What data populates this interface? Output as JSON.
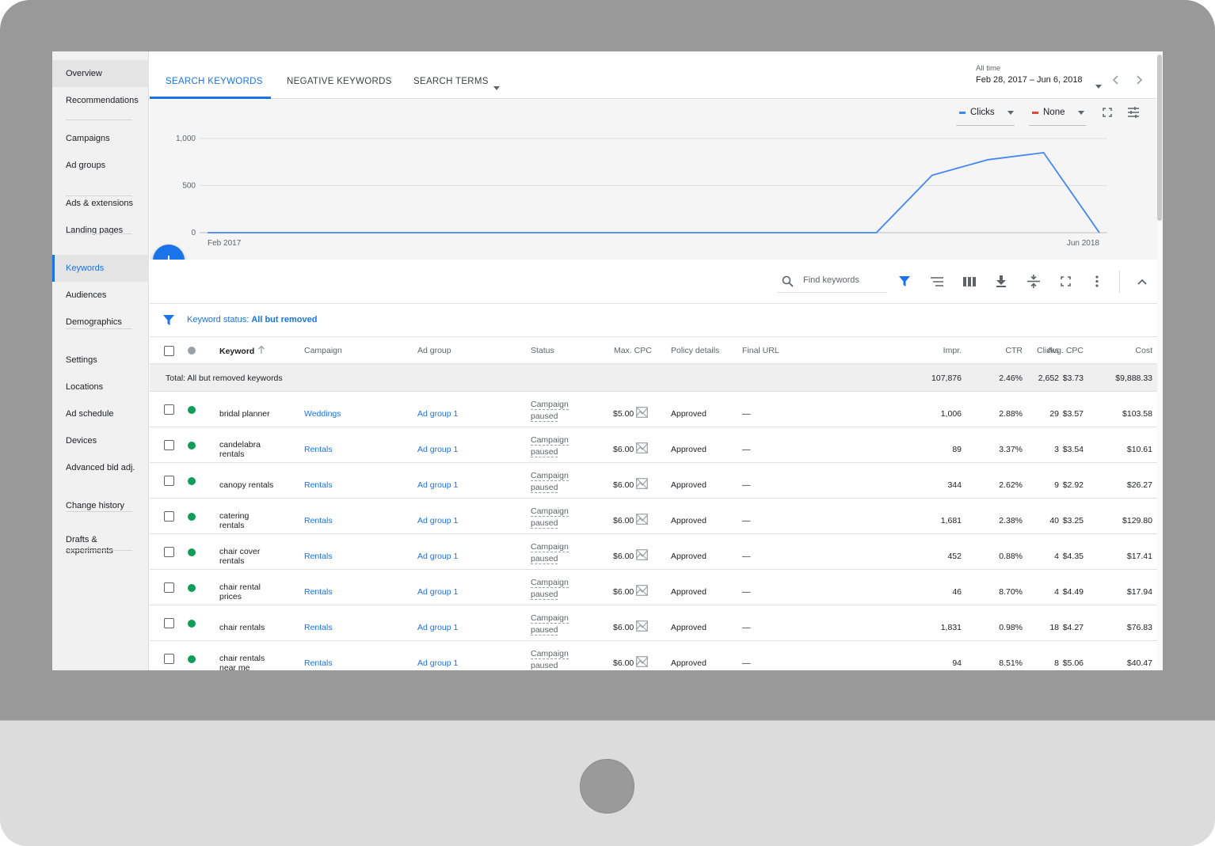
{
  "sidebar": {
    "items": [
      {
        "label": "Overview"
      },
      {
        "label": "Recommendations"
      },
      {
        "label": "Campaigns"
      },
      {
        "label": "Ad groups"
      },
      {
        "label": "Ads & extensions"
      },
      {
        "label": "Landing pages"
      },
      {
        "label": "Keywords"
      },
      {
        "label": "Audiences"
      },
      {
        "label": "Demographics"
      },
      {
        "label": "Settings"
      },
      {
        "label": "Locations"
      },
      {
        "label": "Ad schedule"
      },
      {
        "label": "Devices"
      },
      {
        "label": "Advanced bid adj."
      },
      {
        "label": "Change history"
      },
      {
        "label": "Drafts & experiments"
      }
    ],
    "active": "Keywords"
  },
  "tabs": [
    {
      "label": "SEARCH KEYWORDS",
      "active": true
    },
    {
      "label": "NEGATIVE KEYWORDS",
      "active": false
    },
    {
      "label": "SEARCH TERMS",
      "active": false
    }
  ],
  "date_range": {
    "label": "All time",
    "value": "Feb 28, 2017 – Jun 6, 2018"
  },
  "chart_controls": {
    "metric1": "Clicks",
    "metric1_color": "#4285f4",
    "metric2": "None",
    "metric2_color": "#ea4335"
  },
  "chart_data": {
    "type": "line",
    "x_labels": [
      "Feb 2017",
      "Jun 2018"
    ],
    "y_ticks": [
      "1,000",
      "500",
      "0"
    ],
    "ylim": [
      0,
      1000
    ],
    "series": [
      {
        "color": "#4285f4",
        "x": [
          "Feb 2017",
          "Mar 2017",
          "Apr 2017",
          "May 2017",
          "Jun 2017",
          "Jul 2017",
          "Aug 2017",
          "Sep 2017",
          "Oct 2017",
          "Nov 2017",
          "Dec 2017",
          "Jan 2018",
          "Feb 2018",
          "Mar 2018",
          "Apr 2018",
          "May 2018",
          "Jun 2018"
        ],
        "values": [
          0,
          0,
          0,
          0,
          0,
          0,
          0,
          0,
          0,
          0,
          0,
          0,
          0,
          610,
          775,
          850,
          0
        ]
      }
    ]
  },
  "toolbar": {
    "search_placeholder": "Find keywords"
  },
  "filter": {
    "prefix": "Keyword status:",
    "value": "All but removed"
  },
  "table": {
    "columns": {
      "keyword": "Keyword",
      "campaign": "Campaign",
      "ad_group": "Ad group",
      "status": "Status",
      "max_cpc": "Max. CPC",
      "policy": "Policy details",
      "final_url": "Final URL",
      "clicks": "Clicks",
      "impr": "Impr.",
      "ctr": "CTR",
      "avg_cpc": "Avg. CPC",
      "cost": "Cost"
    },
    "total": {
      "label": "Total: All but removed keywords",
      "clicks": "2,652",
      "impr": "107,876",
      "ctr": "2.46%",
      "avg_cpc": "$3.73",
      "cost": "$9,888.33"
    },
    "status_dot_color": "#0f9d58",
    "rows": [
      {
        "keyword": "bridal planner",
        "campaign": "Weddings",
        "ad_group": "Ad group 1",
        "status1": "Campaign",
        "status2": "paused",
        "max_cpc": "$5.00",
        "policy": "Approved",
        "final_url": "—",
        "clicks": "29",
        "impr": "1,006",
        "ctr": "2.88%",
        "avg_cpc": "$3.57",
        "cost": "$103.58"
      },
      {
        "keyword": "candelabra rentals",
        "campaign": "Rentals",
        "ad_group": "Ad group 1",
        "status1": "Campaign",
        "status2": "paused",
        "max_cpc": "$6.00",
        "policy": "Approved",
        "final_url": "—",
        "clicks": "3",
        "impr": "89",
        "ctr": "3.37%",
        "avg_cpc": "$3.54",
        "cost": "$10.61"
      },
      {
        "keyword": "canopy rentals",
        "campaign": "Rentals",
        "ad_group": "Ad group 1",
        "status1": "Campaign",
        "status2": "paused",
        "max_cpc": "$6.00",
        "policy": "Approved",
        "final_url": "—",
        "clicks": "9",
        "impr": "344",
        "ctr": "2.62%",
        "avg_cpc": "$2.92",
        "cost": "$26.27"
      },
      {
        "keyword": "catering rentals",
        "campaign": "Rentals",
        "ad_group": "Ad group 1",
        "status1": "Campaign",
        "status2": "paused",
        "max_cpc": "$6.00",
        "policy": "Approved",
        "final_url": "—",
        "clicks": "40",
        "impr": "1,681",
        "ctr": "2.38%",
        "avg_cpc": "$3.25",
        "cost": "$129.80"
      },
      {
        "keyword": "chair cover rentals",
        "campaign": "Rentals",
        "ad_group": "Ad group 1",
        "status1": "Campaign",
        "status2": "paused",
        "max_cpc": "$6.00",
        "policy": "Approved",
        "final_url": "—",
        "clicks": "4",
        "impr": "452",
        "ctr": "0.88%",
        "avg_cpc": "$4.35",
        "cost": "$17.41"
      },
      {
        "keyword": "chair rental prices",
        "campaign": "Rentals",
        "ad_group": "Ad group 1",
        "status1": "Campaign",
        "status2": "paused",
        "max_cpc": "$6.00",
        "policy": "Approved",
        "final_url": "—",
        "clicks": "4",
        "impr": "46",
        "ctr": "8.70%",
        "avg_cpc": "$4.49",
        "cost": "$17.94"
      },
      {
        "keyword": "chair rentals",
        "campaign": "Rentals",
        "ad_group": "Ad group 1",
        "status1": "Campaign",
        "status2": "paused",
        "max_cpc": "$6.00",
        "policy": "Approved",
        "final_url": "—",
        "clicks": "18",
        "impr": "1,831",
        "ctr": "0.98%",
        "avg_cpc": "$4.27",
        "cost": "$76.83"
      },
      {
        "keyword": "chair rentals near me",
        "campaign": "Rentals",
        "ad_group": "Ad group 1",
        "status1": "Campaign",
        "status2": "paused",
        "max_cpc": "$6.00",
        "policy": "Approved",
        "final_url": "—",
        "clicks": "8",
        "impr": "94",
        "ctr": "8.51%",
        "avg_cpc": "$5.06",
        "cost": "$40.47"
      }
    ]
  },
  "colors": {
    "accent": "#1a73e8",
    "chart_line": "#4285f4",
    "status_green": "#0f9d58"
  }
}
